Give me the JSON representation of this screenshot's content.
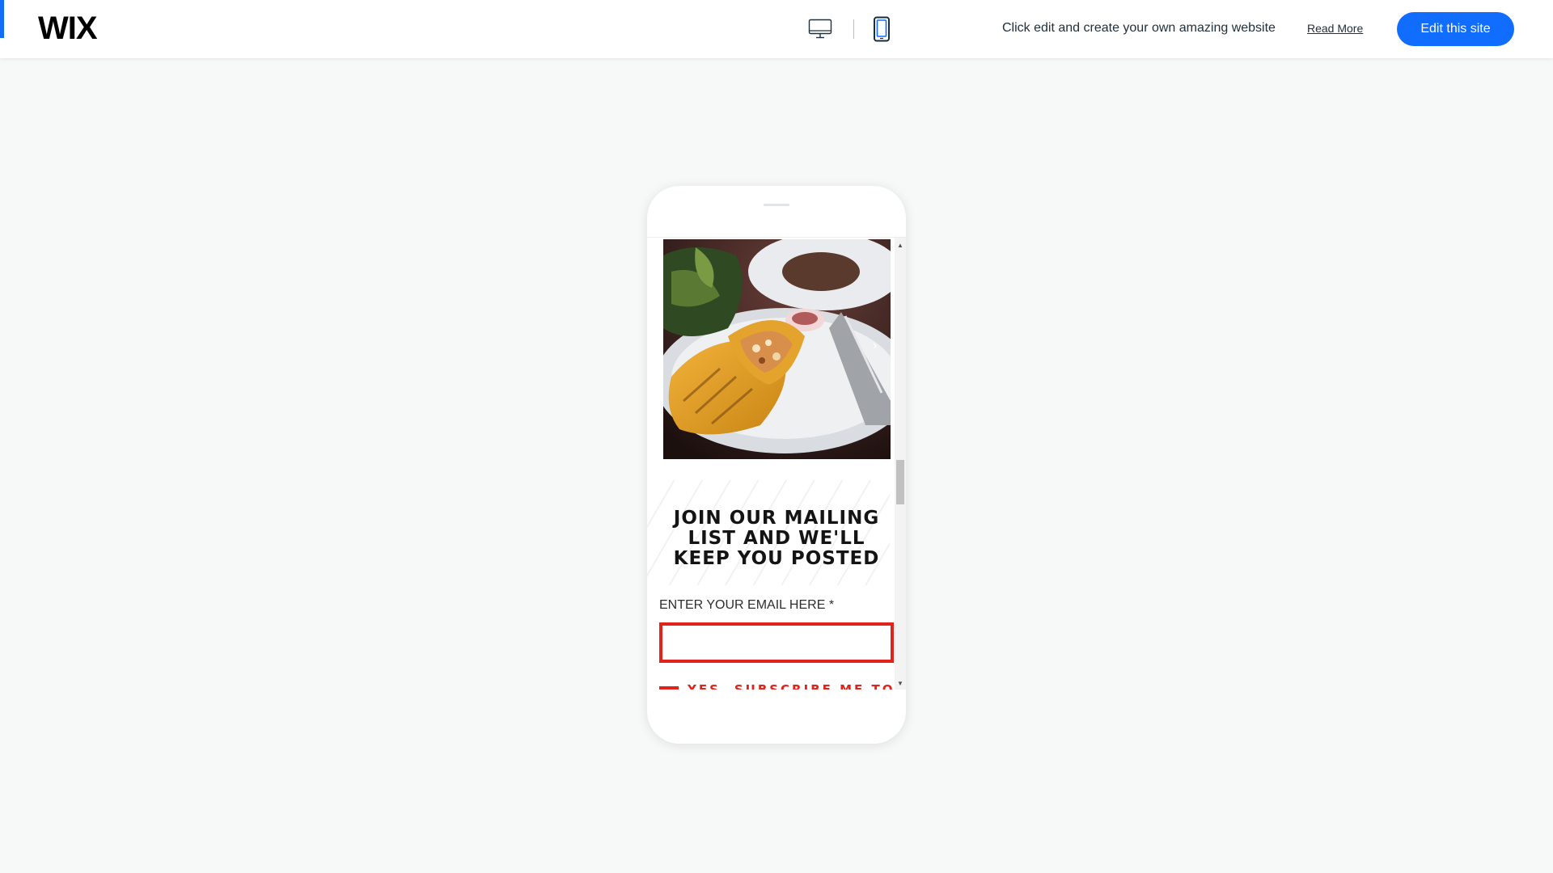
{
  "header": {
    "logo": "WIX",
    "tagline": "Click edit and create your own amazing website",
    "read_more": "Read More",
    "edit_button": "Edit this site",
    "devices": [
      {
        "name": "desktop",
        "icon": "desktop-icon",
        "selected": false
      },
      {
        "name": "mobile",
        "icon": "mobile-icon",
        "selected": true
      }
    ]
  },
  "site": {
    "slideshow_next": "›",
    "headline": "JOIN OUR MAILING LIST AND WE'LL KEEP YOU POSTED",
    "email_label": "ENTER YOUR EMAIL HERE *",
    "email_value": "",
    "subscribe_label": "YES, SUBSCRIBE ME TO"
  },
  "colors": {
    "accent": "#116dff",
    "error_red": "#e0241b",
    "page_bg": "#f7f8f8"
  }
}
